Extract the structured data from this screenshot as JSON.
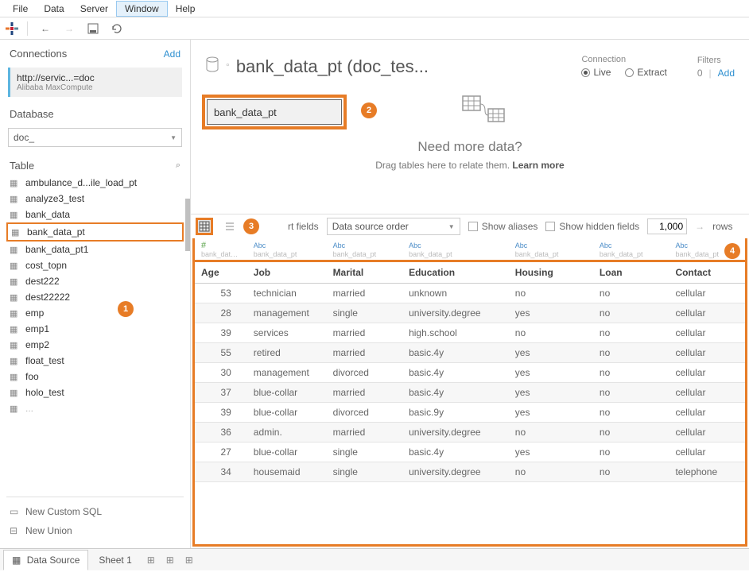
{
  "menu": [
    "File",
    "Data",
    "Server",
    "Window",
    "Help"
  ],
  "menu_active_index": 3,
  "sidebar": {
    "connections_label": "Connections",
    "add_label": "Add",
    "connection": {
      "url": "http://servic...=doc",
      "provider": "Alibaba MaxCompute"
    },
    "database_label": "Database",
    "database_selected": "doc_",
    "table_label": "Table",
    "tables": [
      "ambulance_d...ile_load_pt",
      "analyze3_test",
      "bank_data",
      "bank_data_pt",
      "bank_data_pt1",
      "cost_topn",
      "dest222",
      "dest22222",
      "emp",
      "emp1",
      "emp2",
      "float_test",
      "foo",
      "holo_test"
    ],
    "table_highlight_index": 3,
    "new_custom_sql": "New Custom SQL",
    "new_union": "New Union"
  },
  "datasource": {
    "title": "bank_data_pt (doc_tes...",
    "connection_label": "Connection",
    "live_label": "Live",
    "extract_label": "Extract",
    "live_selected": true,
    "filters_label": "Filters",
    "filters_count": "0",
    "filters_add": "Add"
  },
  "canvas": {
    "chip_label": "bank_data_pt",
    "need_more": "Need more data?",
    "drag_text": "Drag tables here to relate them. ",
    "learn_more": "Learn more"
  },
  "grid_toolbar": {
    "sort_label": "rt fields",
    "sort_value": "Data source order",
    "show_aliases": "Show aliases",
    "show_hidden": "Show hidden fields",
    "rows_value": "1,000",
    "rows_label": "rows"
  },
  "grid": {
    "columns": [
      {
        "type": "#",
        "src": "bank_data_pt",
        "name": "Age",
        "kind": "num"
      },
      {
        "type": "Abc",
        "src": "bank_data_pt",
        "name": "Job",
        "kind": "str"
      },
      {
        "type": "Abc",
        "src": "bank_data_pt",
        "name": "Marital",
        "kind": "str"
      },
      {
        "type": "Abc",
        "src": "bank_data_pt",
        "name": "Education",
        "kind": "str"
      },
      {
        "type": "Abc",
        "src": "bank_data_pt",
        "name": "Housing",
        "kind": "str"
      },
      {
        "type": "Abc",
        "src": "bank_data_pt",
        "name": "Loan",
        "kind": "str"
      },
      {
        "type": "Abc",
        "src": "bank_data_pt",
        "name": "Contact",
        "kind": "str"
      }
    ],
    "rows": [
      [
        "53",
        "technician",
        "married",
        "unknown",
        "no",
        "no",
        "cellular"
      ],
      [
        "28",
        "management",
        "single",
        "university.degree",
        "yes",
        "no",
        "cellular"
      ],
      [
        "39",
        "services",
        "married",
        "high.school",
        "no",
        "no",
        "cellular"
      ],
      [
        "55",
        "retired",
        "married",
        "basic.4y",
        "yes",
        "no",
        "cellular"
      ],
      [
        "30",
        "management",
        "divorced",
        "basic.4y",
        "yes",
        "no",
        "cellular"
      ],
      [
        "37",
        "blue-collar",
        "married",
        "basic.4y",
        "yes",
        "no",
        "cellular"
      ],
      [
        "39",
        "blue-collar",
        "divorced",
        "basic.9y",
        "yes",
        "no",
        "cellular"
      ],
      [
        "36",
        "admin.",
        "married",
        "university.degree",
        "no",
        "no",
        "cellular"
      ],
      [
        "27",
        "blue-collar",
        "single",
        "basic.4y",
        "yes",
        "no",
        "cellular"
      ],
      [
        "34",
        "housemaid",
        "single",
        "university.degree",
        "no",
        "no",
        "telephone"
      ]
    ]
  },
  "callouts": {
    "1": "1",
    "2": "2",
    "3": "3",
    "4": "4"
  },
  "tabs": {
    "data_source": "Data Source",
    "sheet1": "Sheet 1"
  }
}
